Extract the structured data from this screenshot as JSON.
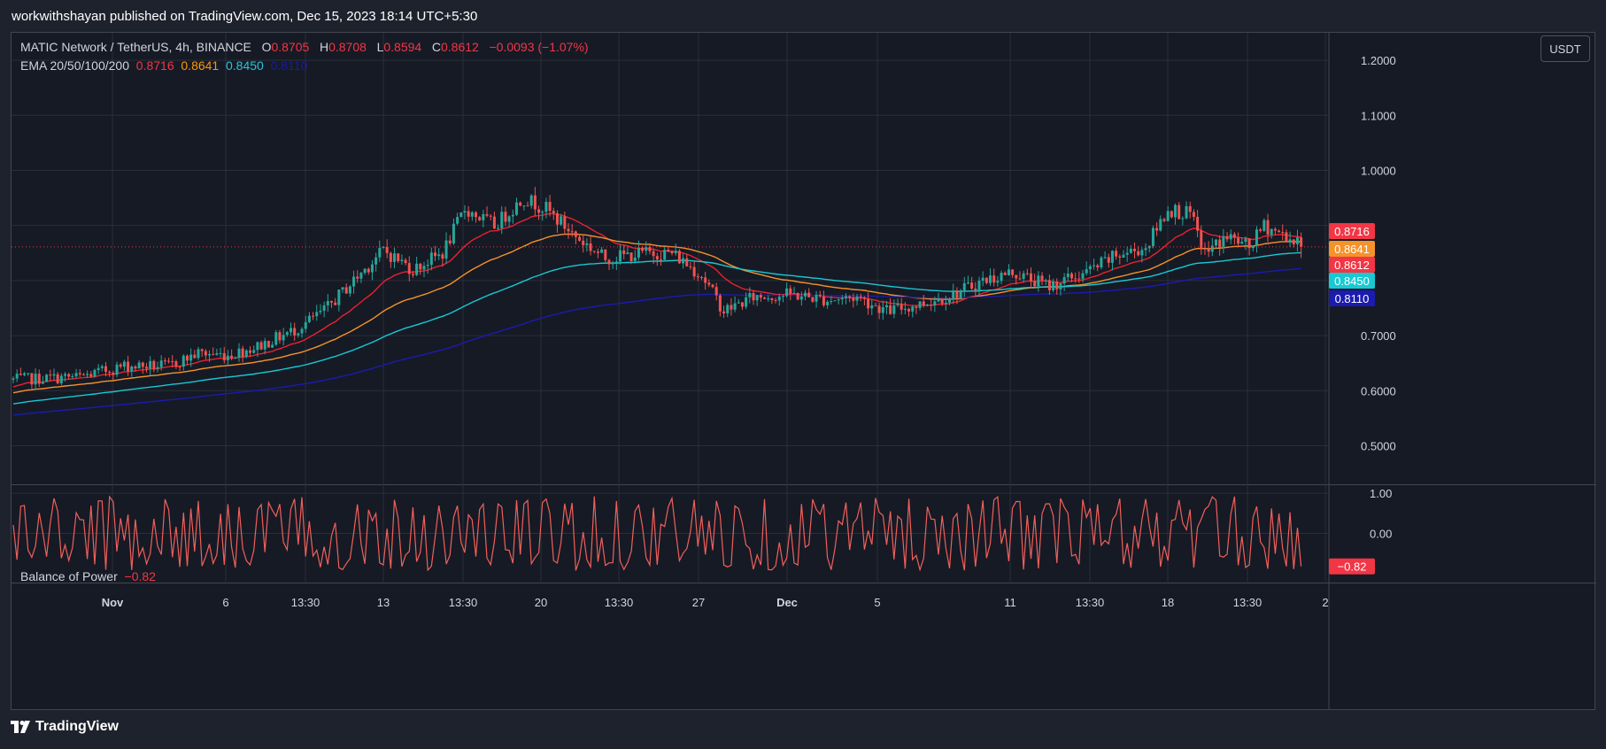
{
  "header": {
    "published": "workwithshayan published on TradingView.com, Dec 15, 2023 18:14 UTC+5:30"
  },
  "footer": {
    "brand": "TradingView"
  },
  "unit_button": "USDT",
  "legend": {
    "symbol": "MATIC Network / TetherUS, 4h, BINANCE",
    "o_label": "O",
    "o_value": "0.8705",
    "h_label": "H",
    "h_value": "0.8708",
    "l_label": "L",
    "l_value": "0.8594",
    "c_label": "C",
    "c_value": "0.8612",
    "change": "−0.0093 (−1.07%)",
    "ema_label": "EMA 20/50/100/200",
    "ema20": "0.8716",
    "ema50": "0.8641",
    "ema100": "0.8450",
    "ema200": "0.8110",
    "bop_label": "Balance of Power",
    "bop_value": "−0.82"
  },
  "colors": {
    "up": "#26a69a",
    "down": "#ef5350",
    "ema20": "#e8222e",
    "ema50": "#f5922a",
    "ema100": "#17c9d3",
    "ema200": "#1b1bb0",
    "bop": "#f0605a",
    "grid": "#2a2e39"
  },
  "chart_data": [
    {
      "type": "candlestick",
      "title": "MATIC Network / TetherUS, 4h, BINANCE",
      "y_ticks": [
        "1.2000",
        "1.1000",
        "1.0000",
        "0.7000",
        "0.6000",
        "0.5000"
      ],
      "y_tick_values": [
        1.2,
        1.1,
        1.0,
        0.7,
        0.6,
        0.5
      ],
      "x_ticks": [
        "Nov",
        "6",
        "13:30",
        "13",
        "13:30",
        "20",
        "13:30",
        "27",
        "Dec",
        "5",
        "11",
        "13:30",
        "18",
        "13:30",
        "2"
      ],
      "price_range": [
        0.43,
        1.25
      ],
      "current_price": 0.8612,
      "price_labels": [
        {
          "label": "0.8716",
          "value": 0.8716,
          "color": "#f23645"
        },
        {
          "label": "0.8641",
          "value": 0.8641,
          "color": "#f5922a"
        },
        {
          "label": "0.8612",
          "value": 0.8612,
          "color": "#f23645"
        },
        {
          "label": "0.8450",
          "value": 0.845,
          "color": "#17c9d3"
        },
        {
          "label": "0.8110",
          "value": 0.811,
          "color": "#1b1bb0"
        }
      ],
      "close_anchors": [
        [
          0,
          0.62
        ],
        [
          18,
          0.625
        ],
        [
          30,
          0.645
        ],
        [
          42,
          0.645
        ],
        [
          50,
          0.668
        ],
        [
          58,
          0.665
        ],
        [
          66,
          0.68
        ],
        [
          76,
          0.71
        ],
        [
          84,
          0.745
        ],
        [
          92,
          0.8
        ],
        [
          100,
          0.855
        ],
        [
          108,
          0.82
        ],
        [
          116,
          0.85
        ],
        [
          122,
          0.93
        ],
        [
          130,
          0.9
        ],
        [
          138,
          0.95
        ],
        [
          144,
          0.93
        ],
        [
          152,
          0.88
        ],
        [
          160,
          0.84
        ],
        [
          170,
          0.85
        ],
        [
          178,
          0.85
        ],
        [
          186,
          0.81
        ],
        [
          192,
          0.745
        ],
        [
          200,
          0.77
        ],
        [
          210,
          0.775
        ],
        [
          220,
          0.765
        ],
        [
          228,
          0.77
        ],
        [
          236,
          0.745
        ],
        [
          244,
          0.755
        ],
        [
          254,
          0.775
        ],
        [
          262,
          0.8
        ],
        [
          270,
          0.815
        ],
        [
          280,
          0.79
        ],
        [
          290,
          0.815
        ],
        [
          298,
          0.845
        ],
        [
          306,
          0.86
        ],
        [
          312,
          0.93
        ],
        [
          318,
          0.92
        ],
        [
          322,
          0.85
        ],
        [
          328,
          0.88
        ],
        [
          334,
          0.86
        ],
        [
          338,
          0.9
        ],
        [
          344,
          0.88
        ],
        [
          348,
          0.861
        ]
      ],
      "candles": 349,
      "ema_periods": [
        20,
        50,
        100,
        200
      ],
      "ema_start": [
        0.605,
        0.595,
        0.575,
        0.555
      ]
    },
    {
      "type": "line",
      "title": "Balance of Power",
      "y_ticks": [
        "1.00",
        "0.00"
      ],
      "y_tick_values": [
        1.0,
        0.0
      ],
      "y_range": [
        -1.2,
        1.2
      ],
      "last_value": -0.82,
      "last_label": "−0.82"
    }
  ]
}
